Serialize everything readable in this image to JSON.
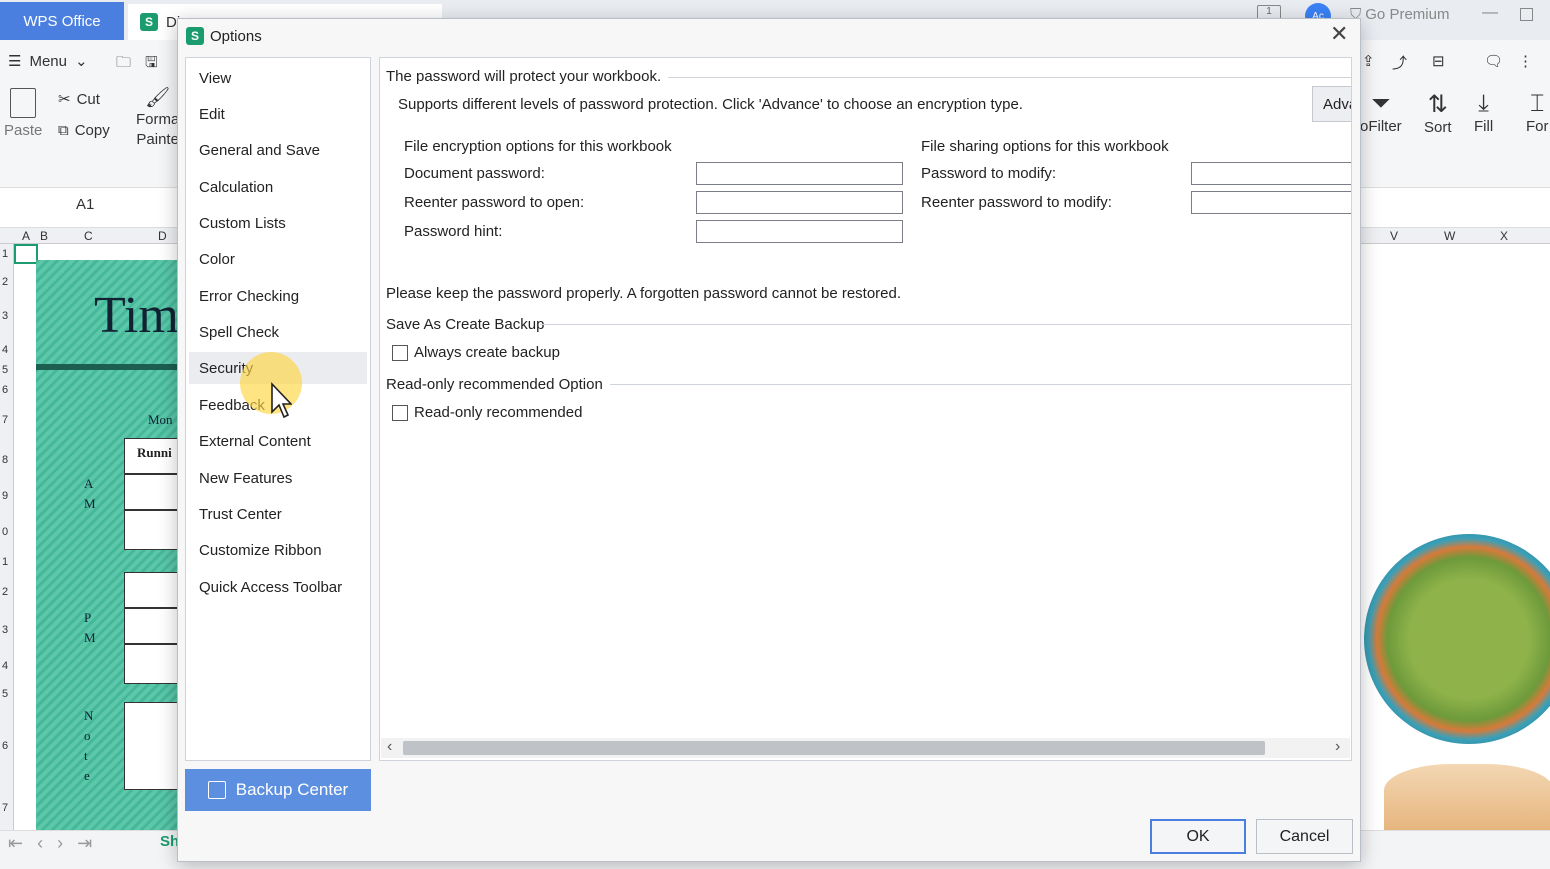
{
  "app": {
    "wps_tab": "WPS Office",
    "doc_tab": "Di",
    "go_premium": "Go Premium",
    "avatar_text": "Ac",
    "tb_box_label": "1",
    "menu_label": "Menu",
    "ribbon": {
      "cut": "Cut",
      "copy": "Copy",
      "paste": "Paste",
      "format_painter_1": "Forma",
      "format_painter_2": "Painte",
      "autofilter": "oFilter",
      "sort": "Sort",
      "fill": "Fill",
      "for": "For"
    },
    "cell_ref": "A1",
    "columns_left": [
      "A",
      "B",
      "C",
      "D"
    ],
    "columns_right": [
      "V",
      "W",
      "X"
    ],
    "rows": [
      "1",
      "2",
      "3",
      "4",
      "5",
      "6",
      "7",
      "8",
      "9",
      "0",
      "1",
      "2",
      "3",
      "4",
      "5",
      "6",
      "7"
    ],
    "sheet_text": {
      "title": "Tim",
      "day": "Mon",
      "running": "Runni",
      "am": [
        "A",
        "M"
      ],
      "pm": [
        "P",
        "M"
      ],
      "note": [
        "N",
        "o",
        "t",
        "e"
      ]
    },
    "sheet_tab": "Sh"
  },
  "dialog": {
    "title": "Options",
    "nav": [
      {
        "label": "View"
      },
      {
        "label": "Edit"
      },
      {
        "label": "General and Save"
      },
      {
        "label": "Calculation"
      },
      {
        "label": "Custom Lists"
      },
      {
        "label": "Color"
      },
      {
        "label": "Error Checking"
      },
      {
        "label": "Spell Check"
      },
      {
        "label": "Security"
      },
      {
        "label": "Feedback"
      },
      {
        "label": "External Content"
      },
      {
        "label": "New Features"
      },
      {
        "label": "Trust Center"
      },
      {
        "label": "Customize Ribbon"
      },
      {
        "label": "Quick Access Toolbar"
      }
    ],
    "active_nav": "Security",
    "security": {
      "header": "The password will protect your workbook.",
      "description": "Supports different levels of password protection. Click 'Advance' to choose an encryption type.",
      "advanced_button": "Advanced",
      "encryption_title": "File encryption options for this workbook",
      "doc_password_label": "Document password:",
      "reenter_open_label": "Reenter password to open:",
      "hint_label": "Password hint:",
      "sharing_title": "File sharing options for this workbook",
      "modify_label": "Password to modify:",
      "reenter_modify_label": "Reenter password to modify:",
      "warning": "Please keep the password properly. A forgotten password cannot be restored.",
      "backup_group": "Save As Create Backup",
      "always_backup_label": "Always create backup",
      "always_backup_checked": false,
      "readonly_group": "Read-only recommended Option",
      "readonly_label": "Read-only recommended",
      "readonly_checked": false
    },
    "backup_center": "Backup Center",
    "ok": "OK",
    "cancel": "Cancel"
  },
  "colors": {
    "accent": "#4a7fe0",
    "backup_button": "#5d8fe0",
    "wps_green": "#1a9c6e",
    "cursor_highlight": "#ffd640"
  }
}
